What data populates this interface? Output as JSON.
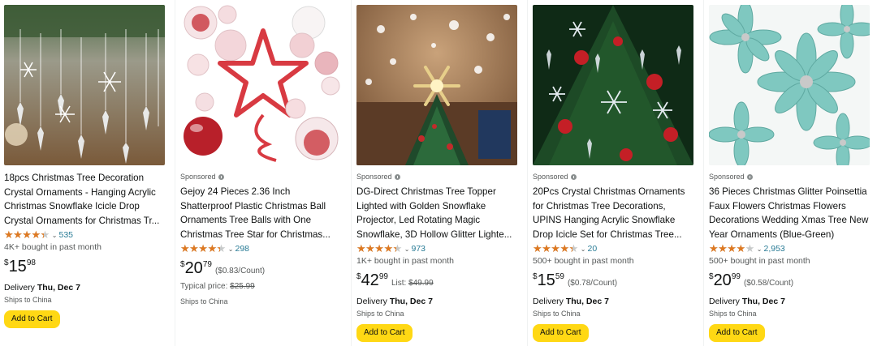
{
  "products": [
    {
      "sponsored": false,
      "title": "18pcs Christmas Tree Decoration Crystal Ornaments - Hanging Acrylic Christmas Snowflake Icicle Drop Crystal Ornaments for Christmas Tr...",
      "rating": 4.4,
      "stars_glyph": "★★★★★",
      "rating_count": "535",
      "bought": "4K+ bought in past month",
      "price_symbol": "$",
      "price_whole": "15",
      "price_fraction": "98",
      "delivery_label": "Delivery",
      "delivery_date": "Thu, Dec 7",
      "ships": "Ships to China",
      "cta": "Add to Cart",
      "image_icon": "crystal-ornaments-image"
    },
    {
      "sponsored": true,
      "sponsored_label": "Sponsored",
      "title": "Gejoy 24 Pieces 2.36 Inch Shatterproof Plastic Christmas Ball Ornaments Tree Balls with One Christmas Tree Star for Christmas...",
      "rating": 4.4,
      "stars_glyph": "★★★★★",
      "rating_count": "298",
      "price_symbol": "$",
      "price_whole": "20",
      "price_fraction": "79",
      "unit_price": "($0.83/Count)",
      "typical_label": "Typical price:",
      "typical_price": "$25.99",
      "ships": "Ships to China",
      "image_icon": "ball-ornaments-star-image"
    },
    {
      "sponsored": true,
      "sponsored_label": "Sponsored",
      "title": "DG-Direct Christmas Tree Topper Lighted with Golden Snowflake Projector, Led Rotating Magic Snowflake, 3D Hollow Glitter Lighte...",
      "rating": 4.4,
      "stars_glyph": "★★★★★",
      "rating_count": "973",
      "bought": "1K+ bought in past month",
      "price_symbol": "$",
      "price_whole": "42",
      "price_fraction": "99",
      "list_label": "List:",
      "list_price": "$49.99",
      "delivery_label": "Delivery",
      "delivery_date": "Thu, Dec 7",
      "ships": "Ships to China",
      "cta": "Add to Cart",
      "image_icon": "snowflake-topper-image"
    },
    {
      "sponsored": true,
      "sponsored_label": "Sponsored",
      "title": "20Pcs Crystal Christmas Ornaments for Christmas Tree Decorations, UPINS Hanging Acrylic Snowflake Drop Icicle Set for Christmas Tree...",
      "rating": 4.4,
      "stars_glyph": "★★★★★",
      "rating_count": "20",
      "bought": "500+ bought in past month",
      "price_symbol": "$",
      "price_whole": "15",
      "price_fraction": "59",
      "unit_price": "($0.78/Count)",
      "delivery_label": "Delivery",
      "delivery_date": "Thu, Dec 7",
      "ships": "Ships to China",
      "cta": "Add to Cart",
      "image_icon": "snowflake-icicle-tree-image"
    },
    {
      "sponsored": true,
      "sponsored_label": "Sponsored",
      "title": "36 Pieces Christmas Glitter Poinsettia Faux Flowers Christmas Flowers Decorations Wedding Xmas Tree New Year Ornaments (Blue-Green)",
      "rating": 3.9,
      "stars_glyph": "★★★★★",
      "rating_count": "2,953",
      "bought": "500+ bought in past month",
      "price_symbol": "$",
      "price_whole": "20",
      "price_fraction": "99",
      "unit_price": "($0.58/Count)",
      "delivery_label": "Delivery",
      "delivery_date": "Thu, Dec 7",
      "ships": "Ships to China",
      "cta": "Add to Cart",
      "image_icon": "poinsettia-flowers-image"
    }
  ],
  "colors": {
    "star": "#de7921",
    "link": "#2a7c96",
    "button": "#ffd814",
    "muted": "#565959"
  }
}
